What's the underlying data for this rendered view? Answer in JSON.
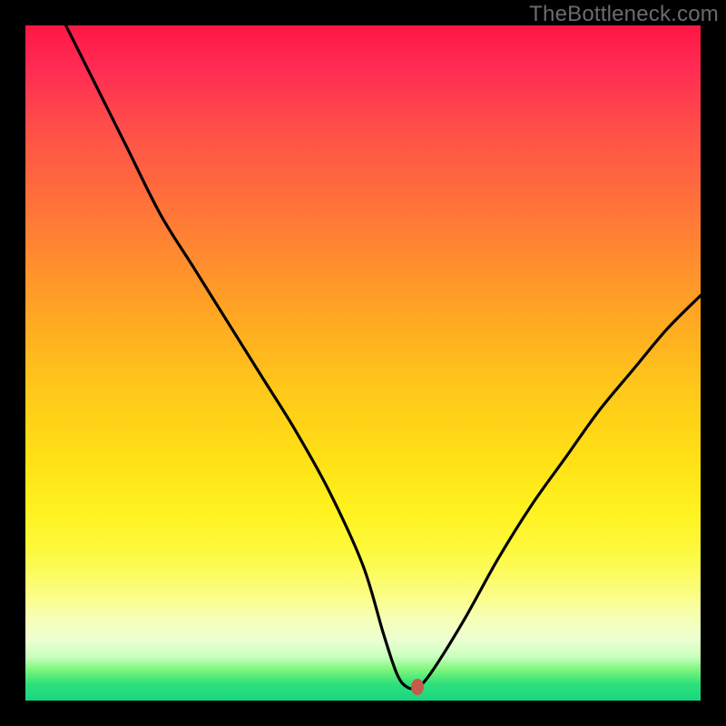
{
  "watermark": "TheBottleneck.com",
  "colors": {
    "frame": "#000000",
    "curve": "#000000",
    "marker": "#c85a4a",
    "watermark": "#6b6b6b"
  },
  "chart_data": {
    "type": "line",
    "title": "",
    "xlabel": "",
    "ylabel": "",
    "xlim": [
      0,
      100
    ],
    "ylim": [
      0,
      100
    ],
    "grid": false,
    "legend": false,
    "series": [
      {
        "name": "bottleneck-curve",
        "x": [
          6,
          10,
          15,
          20,
          25,
          30,
          35,
          40,
          45,
          50,
          53,
          55,
          56.5,
          58,
          60,
          65,
          70,
          75,
          80,
          85,
          90,
          95,
          100
        ],
        "values": [
          100,
          92,
          82,
          72,
          64,
          56,
          48,
          40,
          31,
          20,
          10,
          4,
          2,
          2,
          4,
          12,
          21,
          29,
          36,
          43,
          49,
          55,
          60
        ]
      }
    ],
    "marker": {
      "x": 58,
      "y": 2
    },
    "notes": "Values read from pixel positions; no axes or tick labels present. x and y normalized 0–100 across visible plot area."
  }
}
